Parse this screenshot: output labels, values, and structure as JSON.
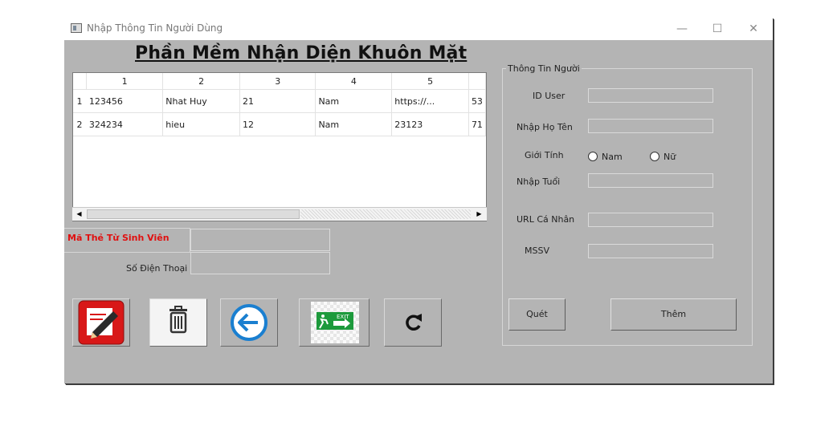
{
  "window": {
    "title": "Nhập Thông Tin Người Dùng",
    "controls": {
      "minimize": "—",
      "maximize": "☐",
      "close": "✕"
    }
  },
  "heading": "Phần Mềm Nhận Diện Khuôn Mặt",
  "table": {
    "columns": [
      "1",
      "2",
      "3",
      "4",
      "5",
      ""
    ],
    "rows": [
      {
        "num": "1",
        "cells": [
          "123456",
          "Nhat Huy",
          "21",
          "Nam",
          "https://...",
          "53"
        ]
      },
      {
        "num": "2",
        "cells": [
          "324234",
          "hieu",
          "12",
          "Nam",
          "23123",
          "71"
        ]
      }
    ],
    "scroll_left_arrow": "◀",
    "scroll_right_arrow": "▶"
  },
  "left_form": {
    "card_label": "Mã Thẻ Từ Sinh Viên",
    "phone_label": "Số Điện Thoại",
    "card_value": "",
    "phone_value": ""
  },
  "toolbar": {
    "edit_icon": "edit-icon",
    "delete_icon": "trash-icon",
    "back_icon": "back-arrow-icon",
    "exit_icon": "exit-sign-icon",
    "exit_text": "EXIT",
    "refresh_icon": "refresh-icon"
  },
  "info_group": {
    "title": "Thông Tin Người",
    "id_label": "ID User",
    "name_label": "Nhập Họ Tên",
    "gender_label": "Giới Tính",
    "gender_male": "Nam",
    "gender_female": "Nữ",
    "age_label": "Nhập Tuổi",
    "url_label": "URL Cá Nhân",
    "mssv_label": "MSSV",
    "scan_button": "Quét",
    "add_button": "Thêm"
  },
  "colors": {
    "window_bg": "#b4b4b4",
    "red_label": "#e01010",
    "edit_red": "#d81818",
    "back_blue": "#1a7fd0",
    "exit_green": "#1d9a3c"
  }
}
